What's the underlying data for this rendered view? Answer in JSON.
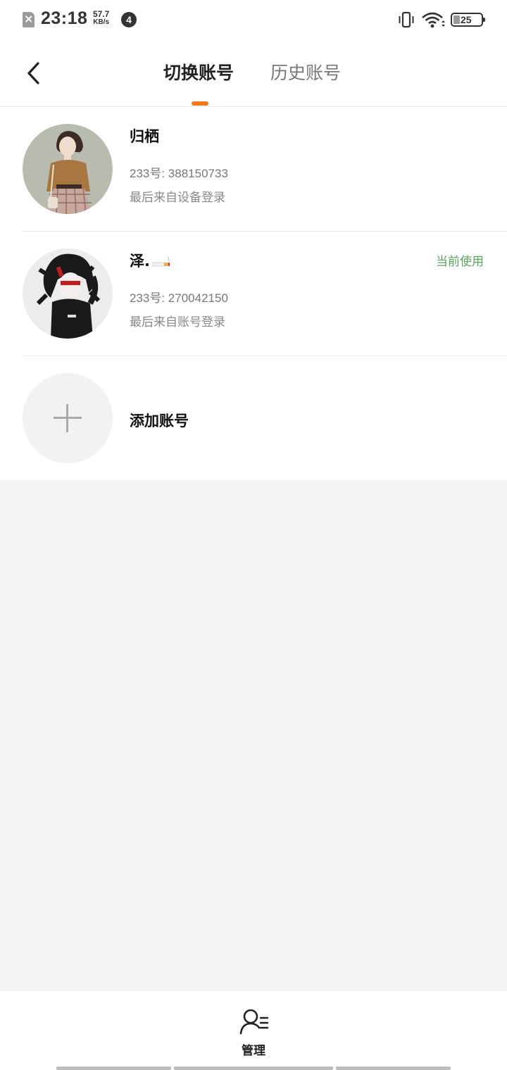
{
  "status_bar": {
    "time": "23:18",
    "net_speed_value": "57.7",
    "net_speed_unit": "KB/s",
    "notification_count": "4",
    "battery": "25"
  },
  "header": {
    "tabs": [
      {
        "label": "切换账号",
        "active": true
      },
      {
        "label": "历史账号",
        "active": false
      }
    ],
    "accent_color": "#f27a1a"
  },
  "accounts": [
    {
      "name": "归栖",
      "account_id": "233号: 388150733",
      "last_login": "最后来自设备登录",
      "current": false
    },
    {
      "name": "泽.",
      "account_id": "233号: 270042150",
      "last_login": "最后来自账号登录",
      "current": true,
      "current_label": "当前使用"
    }
  ],
  "add_account": {
    "label": "添加账号"
  },
  "bottom_bar": {
    "manage_label": "管理"
  },
  "colors": {
    "current_label": "#5aa55a",
    "background": "#f4f4f4"
  }
}
